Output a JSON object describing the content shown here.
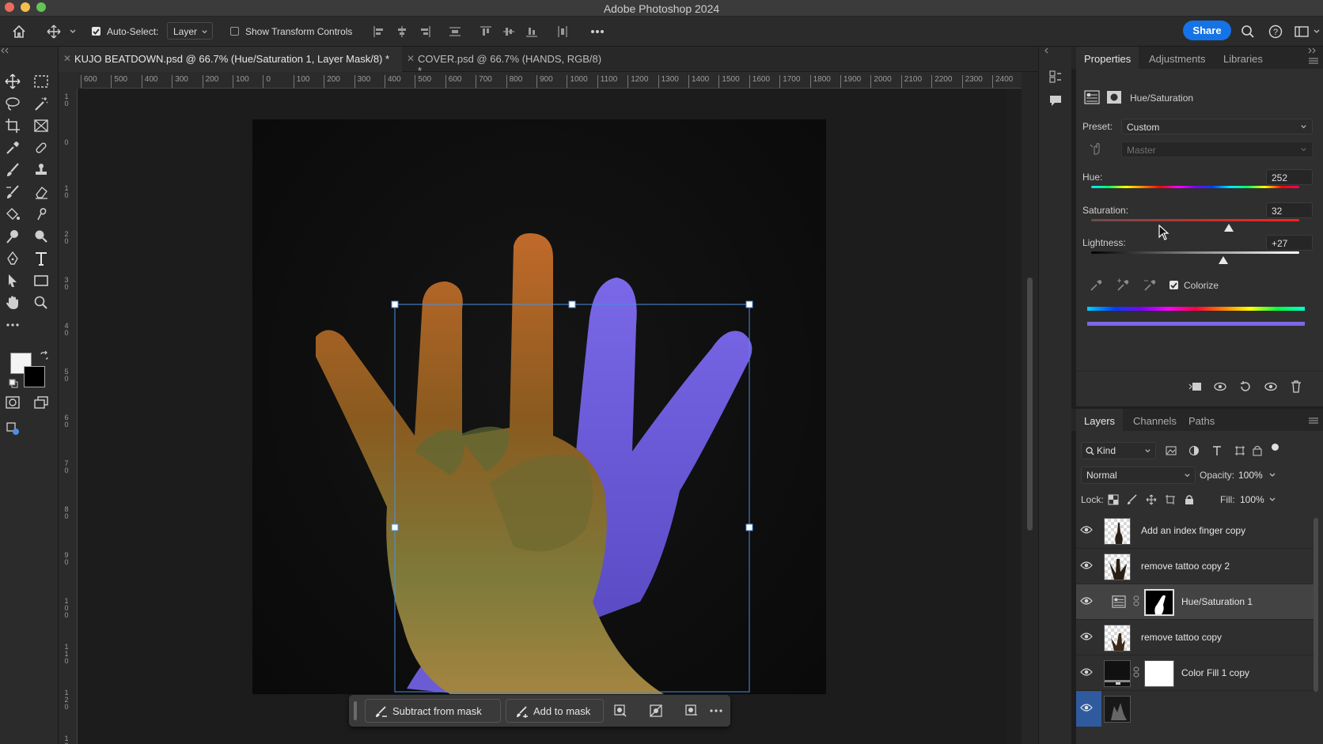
{
  "app": {
    "title": "Adobe Photoshop 2024"
  },
  "options_bar": {
    "auto_select_label": "Auto-Select:",
    "auto_select_value": "Layer",
    "show_transform_label": "Show Transform Controls",
    "share_label": "Share"
  },
  "doc_tabs": [
    {
      "label": "KUJO BEATDOWN.psd @ 66.7% (Hue/Saturation 1, Layer Mask/8) *",
      "active": true
    },
    {
      "label": "COVER.psd @ 66.7% (HANDS, RGB/8) *",
      "active": false
    }
  ],
  "ruler": {
    "h_labels": [
      "600",
      "500",
      "400",
      "300",
      "200",
      "100",
      "0",
      "100",
      "200",
      "300",
      "400",
      "500",
      "600",
      "700",
      "800",
      "900",
      "1000",
      "1100",
      "1200",
      "1300",
      "1400",
      "1500",
      "1600",
      "1700",
      "1800",
      "1900",
      "2000",
      "2100",
      "2200",
      "2300",
      "2400",
      "2500"
    ],
    "v_labels": [
      "1 0",
      "0",
      "1 0",
      "2 0",
      "3 0",
      "4 0",
      "5 0",
      "6 0",
      "7 0",
      "8 0",
      "9 0",
      "1 0 0",
      "1 1 0",
      "1 2 0",
      "1 3 0"
    ]
  },
  "context_bar": {
    "subtract_label": "Subtract from mask",
    "add_label": "Add to mask"
  },
  "properties": {
    "tabs": [
      "Properties",
      "Adjustments",
      "Libraries"
    ],
    "adjustment_name": "Hue/Saturation",
    "preset_label": "Preset:",
    "preset_value": "Custom",
    "channel_value": "Master",
    "hue_label": "Hue:",
    "hue_value": "252",
    "saturation_label": "Saturation:",
    "saturation_value": "32",
    "lightness_label": "Lightness:",
    "lightness_value": "+27",
    "colorize_label": "Colorize",
    "colorize_checked": true,
    "hue_range": [
      -180,
      180
    ],
    "sat_range": [
      -100,
      100
    ],
    "light_range": [
      -100,
      100
    ]
  },
  "layers_panel": {
    "tabs": [
      "Layers",
      "Channels",
      "Paths"
    ],
    "kind_label": "Kind",
    "blend_mode": "Normal",
    "opacity_label": "Opacity:",
    "opacity_value": "100%",
    "lock_label": "Lock:",
    "fill_label": "Fill:",
    "fill_value": "100%",
    "layers": [
      {
        "name": "Add an index finger copy",
        "type": "pixel",
        "selected": false
      },
      {
        "name": "remove tattoo copy 2",
        "type": "pixel",
        "selected": false
      },
      {
        "name": "Hue/Saturation 1",
        "type": "adjustment",
        "selected": true
      },
      {
        "name": "remove tattoo copy",
        "type": "pixel",
        "selected": false
      },
      {
        "name": "Color Fill 1 copy",
        "type": "fill",
        "selected": false
      },
      {
        "name": "",
        "type": "pixel",
        "selected": false
      }
    ]
  },
  "colors": {
    "accent": "#1473e6",
    "selected_layer_bg": "#434343",
    "purple_hand": "#6b5cd6"
  }
}
